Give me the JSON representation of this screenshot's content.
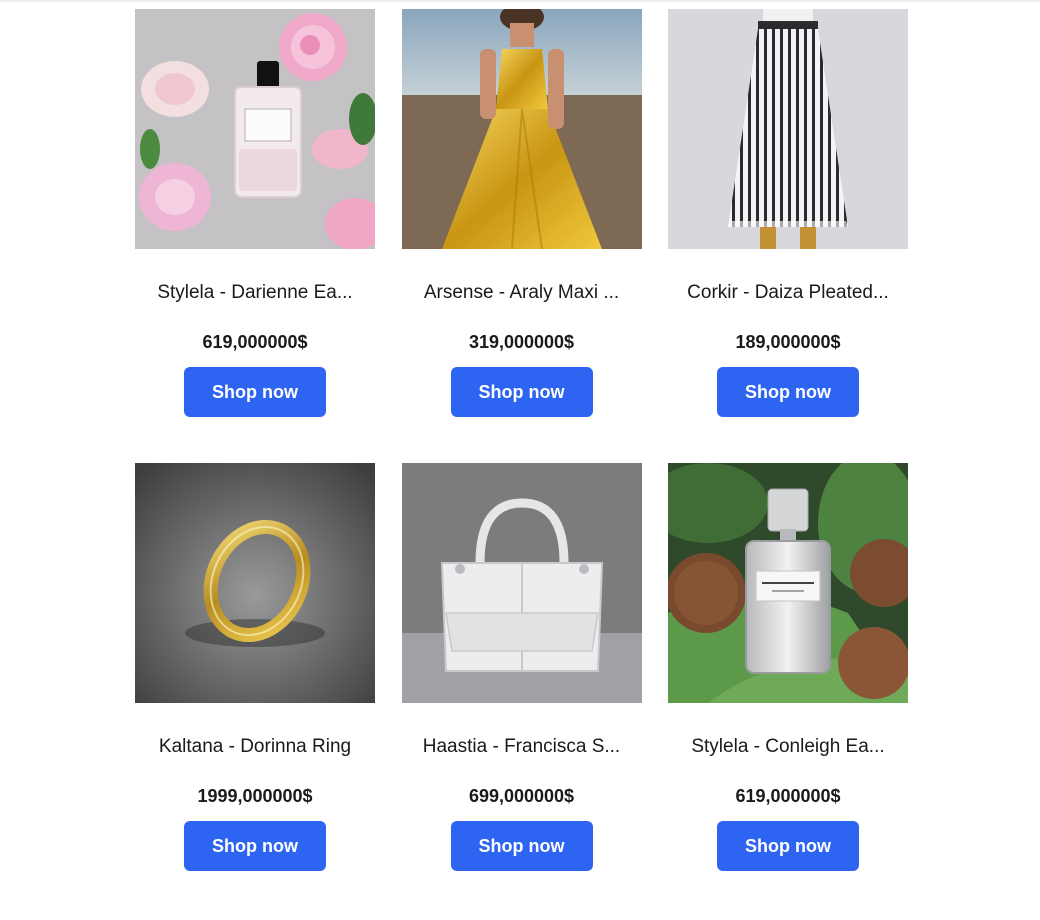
{
  "products": [
    {
      "name": "Stylela - Darienne Ea...",
      "price": "619,000000$",
      "button_label": "Shop now",
      "image": "perfume-with-roses"
    },
    {
      "name": "Arsense - Araly Maxi ...",
      "price": "319,000000$",
      "button_label": "Shop now",
      "image": "gold-maxi-dress"
    },
    {
      "name": "Corkir - Daiza Pleated...",
      "price": "189,000000$",
      "button_label": "Shop now",
      "image": "pleated-skirt"
    },
    {
      "name": "Kaltana - Dorinna Ring",
      "price": "1999,000000$",
      "button_label": "Shop now",
      "image": "gold-ring"
    },
    {
      "name": "Haastia - Francisca S...",
      "price": "699,000000$",
      "button_label": "Shop now",
      "image": "white-handbag"
    },
    {
      "name": "Stylela - Conleigh Ea...",
      "price": "619,000000$",
      "button_label": "Shop now",
      "image": "perfume-with-coconuts"
    }
  ],
  "colors": {
    "button": "#2e64f2",
    "button_text": "#ffffff",
    "text": "#1a1a1a"
  }
}
